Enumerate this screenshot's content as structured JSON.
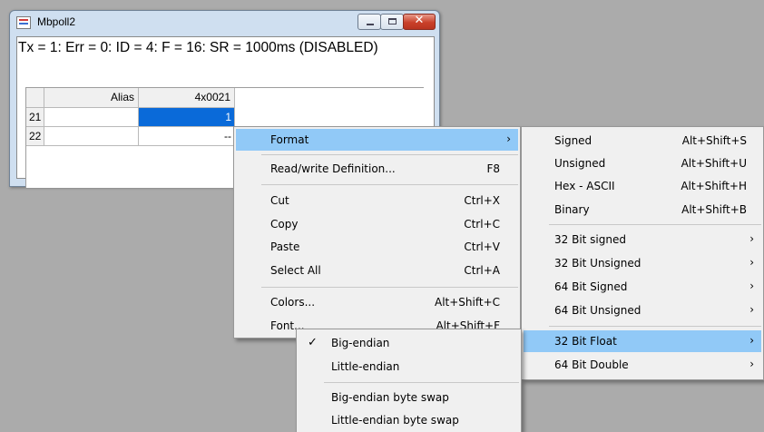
{
  "window": {
    "title": "Mbpoll2",
    "controls": {
      "minimize": "",
      "maximize": "",
      "close": "✕"
    },
    "status_line": "Tx = 1: Err = 0: ID = 4: F = 16: SR = 1000ms  (DISABLED)"
  },
  "grid": {
    "columns": [
      "Alias",
      "4x0021"
    ],
    "rows": [
      {
        "num": "21",
        "alias": "",
        "value": "1"
      },
      {
        "num": "22",
        "alias": "",
        "value": "--"
      }
    ]
  },
  "context_menu": {
    "items": [
      {
        "label": "Format",
        "shortcut": "",
        "submenu": true
      },
      {
        "label": "Read/write Definition...",
        "shortcut": "F8"
      },
      {
        "label": "Cut",
        "shortcut": "Ctrl+X"
      },
      {
        "label": "Copy",
        "shortcut": "Ctrl+C"
      },
      {
        "label": "Paste",
        "shortcut": "Ctrl+V"
      },
      {
        "label": "Select All",
        "shortcut": "Ctrl+A"
      },
      {
        "label": "Colors...",
        "shortcut": "Alt+Shift+C"
      },
      {
        "label": "Font...",
        "shortcut": "Alt+Shift+F"
      }
    ]
  },
  "format_menu": {
    "items": [
      {
        "label": "Signed",
        "shortcut": "Alt+Shift+S"
      },
      {
        "label": "Unsigned",
        "shortcut": "Alt+Shift+U"
      },
      {
        "label": "Hex - ASCII",
        "shortcut": "Alt+Shift+H"
      },
      {
        "label": "Binary",
        "shortcut": "Alt+Shift+B"
      },
      {
        "label": "32 Bit signed",
        "submenu": true
      },
      {
        "label": "32 Bit Unsigned",
        "submenu": true
      },
      {
        "label": "64 Bit Signed",
        "submenu": true
      },
      {
        "label": "64 Bit Unsigned",
        "submenu": true
      },
      {
        "label": "32 Bit Float",
        "submenu": true
      },
      {
        "label": "64 Bit Double",
        "submenu": true
      }
    ]
  },
  "float_menu": {
    "items": [
      {
        "label": "Big-endian",
        "checked": true
      },
      {
        "label": "Little-endian",
        "checked": false
      },
      {
        "label": "Big-endian byte swap",
        "checked": false
      },
      {
        "label": "Little-endian byte swap",
        "checked": false
      }
    ]
  },
  "glyphs": {
    "arrow": "›",
    "check": "✓"
  }
}
